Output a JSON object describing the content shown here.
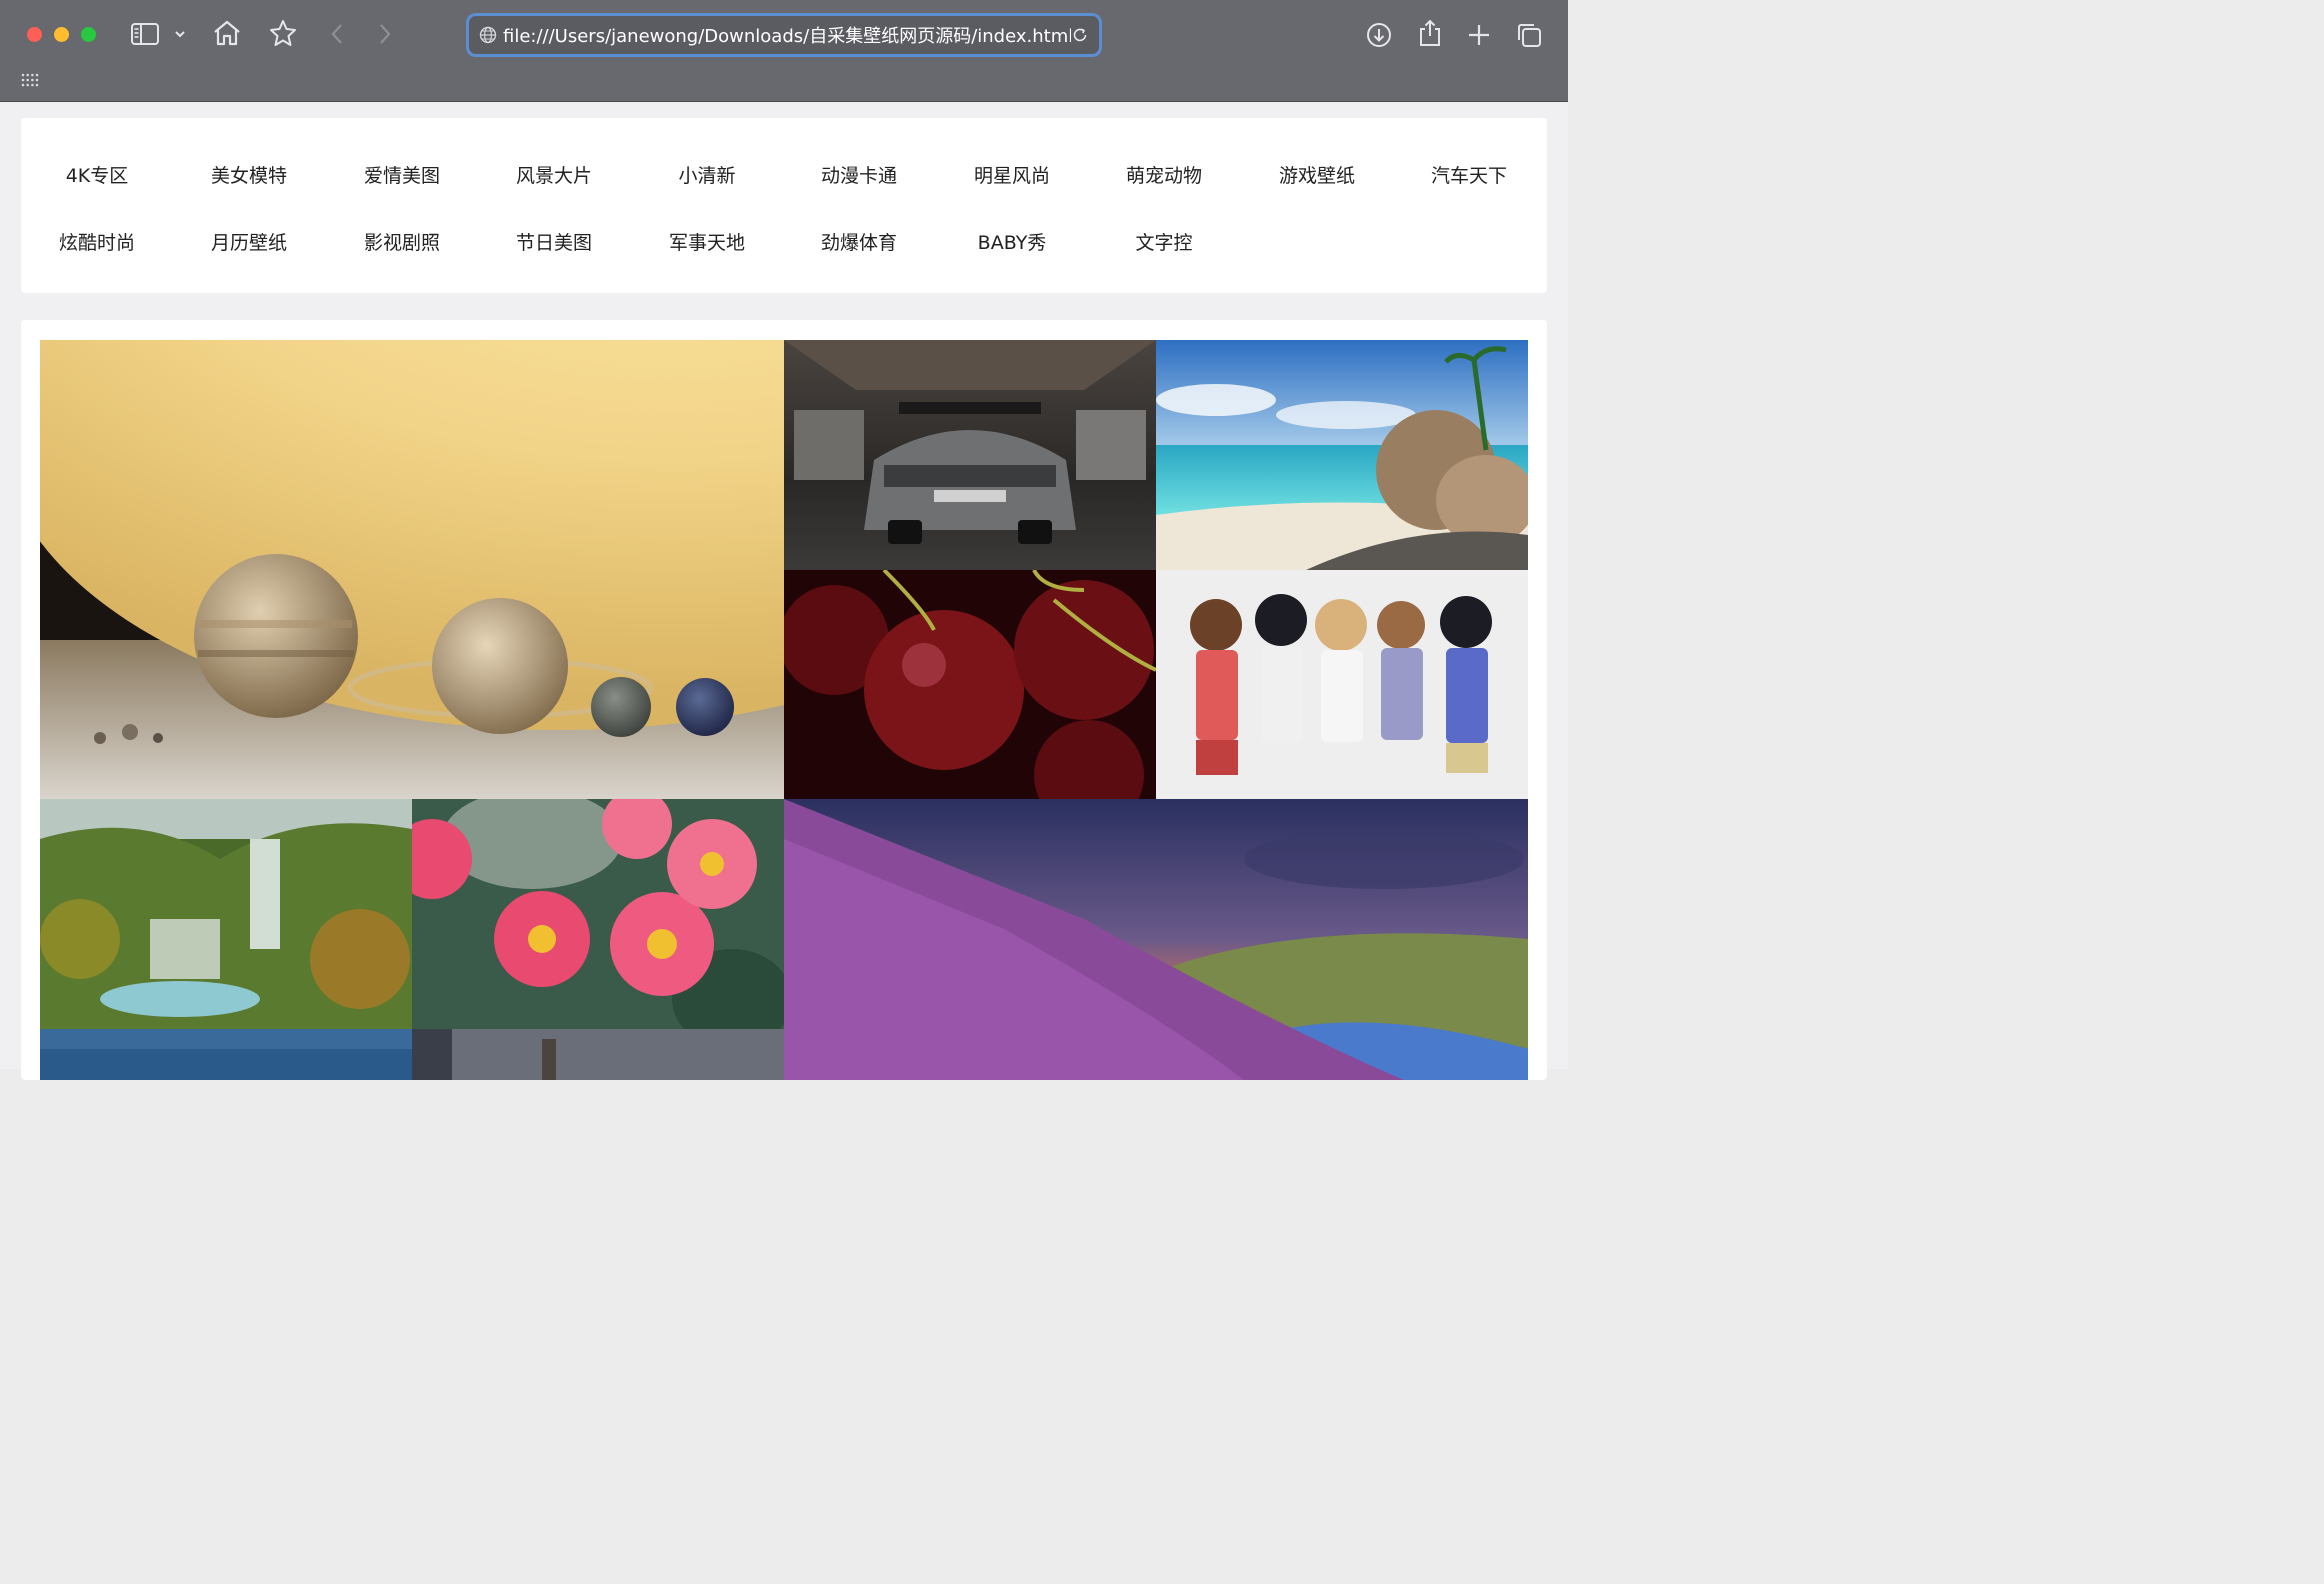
{
  "browser": {
    "url": "file:///Users/janewong/Downloads/自采集壁纸网页源码/index.html"
  },
  "nav": {
    "row1": [
      "4K专区",
      "美女模特",
      "爱情美图",
      "风景大片",
      "小清新",
      "动漫卡通",
      "明星风尚",
      "萌宠动物",
      "游戏壁纸",
      "汽车天下"
    ],
    "row2": [
      "炫酷时尚",
      "月历壁纸",
      "影视剧照",
      "节日美图",
      "军事天地",
      "劲爆体育",
      "BABY秀",
      "文字控"
    ]
  },
  "colors": {
    "chrome_bg": "#68686f",
    "url_focus": "#5c8fd1",
    "page_bg": "#f0f0f2",
    "card_bg": "#ffffff"
  },
  "icons": [
    "sidebar-icon",
    "chevron-down-icon",
    "home-icon",
    "star-icon",
    "back-icon",
    "forward-icon",
    "globe-icon",
    "reload-icon",
    "download-icon",
    "share-icon",
    "new-tab-icon",
    "tabs-overview-icon",
    "tab-grid-icon"
  ]
}
